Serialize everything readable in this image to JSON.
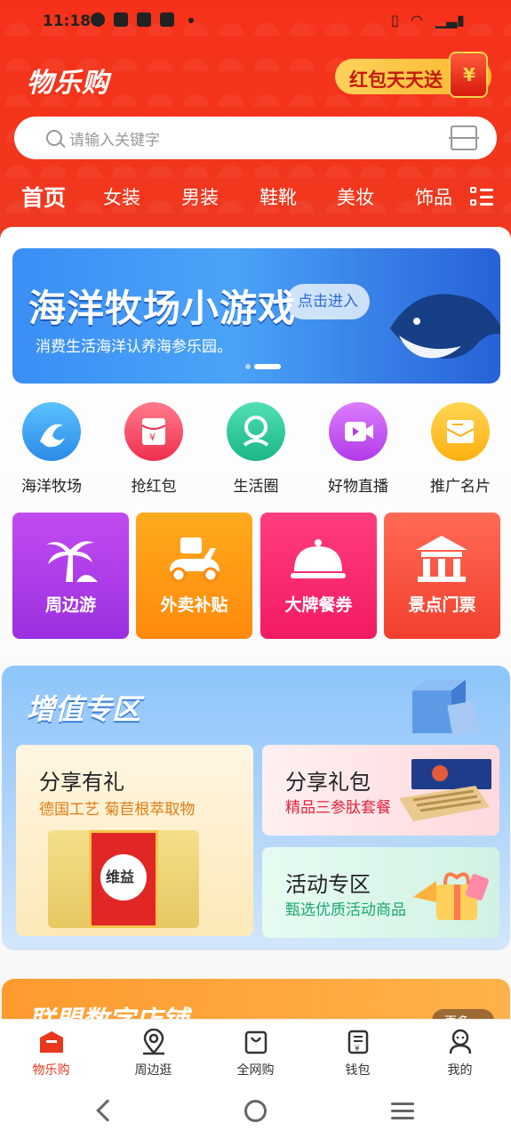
{
  "status": {
    "time": "11:18"
  },
  "header": {
    "brand": "物乐购",
    "promo_label": "红包天天送"
  },
  "search": {
    "placeholder": "请输入关键字"
  },
  "categories": [
    "首页",
    "女装",
    "男装",
    "鞋靴",
    "美妆",
    "饰品"
  ],
  "banner": {
    "title": "海洋牧场小游戏",
    "subtitle": "消费生活海洋认养海参乐园。",
    "button": "点击进入"
  },
  "quick_icons": [
    {
      "label": "海洋牧场",
      "icon": "wave-icon",
      "color": "#3aa8f0"
    },
    {
      "label": "抢红包",
      "icon": "red-packet-icon",
      "color": "#f6405a"
    },
    {
      "label": "生活圈",
      "icon": "people-icon",
      "color": "#27c79a"
    },
    {
      "label": "好物直播",
      "icon": "video-icon",
      "color": "#c24ef0"
    },
    {
      "label": "推广名片",
      "icon": "card-icon",
      "color": "#ffbf22"
    }
  ],
  "tiles": [
    {
      "label": "周边游",
      "icon": "palm-tree-icon"
    },
    {
      "label": "外卖补贴",
      "icon": "scooter-icon"
    },
    {
      "label": "大牌餐券",
      "icon": "cloche-icon"
    },
    {
      "label": "景点门票",
      "icon": "temple-icon"
    }
  ],
  "value_zone": {
    "title": "增值专区",
    "cards": [
      {
        "title": "分享有礼",
        "subtitle": "德国工艺 菊苣根萃取物",
        "product_text": "维益"
      },
      {
        "title": "分享礼包",
        "subtitle": "精品三参肽套餐"
      },
      {
        "title": "活动专区",
        "subtitle": "甄选优质活动商品"
      }
    ]
  },
  "next_section": {
    "title": "联盟数字店铺",
    "more": "更多"
  },
  "tabbar": [
    {
      "label": "物乐购",
      "icon": "shop-icon",
      "active": true
    },
    {
      "label": "周边逛",
      "icon": "location-icon",
      "active": false
    },
    {
      "label": "全网购",
      "icon": "bag-icon",
      "active": false
    },
    {
      "label": "钱包",
      "icon": "wallet-icon",
      "active": false
    },
    {
      "label": "我的",
      "icon": "user-icon",
      "active": false
    }
  ]
}
